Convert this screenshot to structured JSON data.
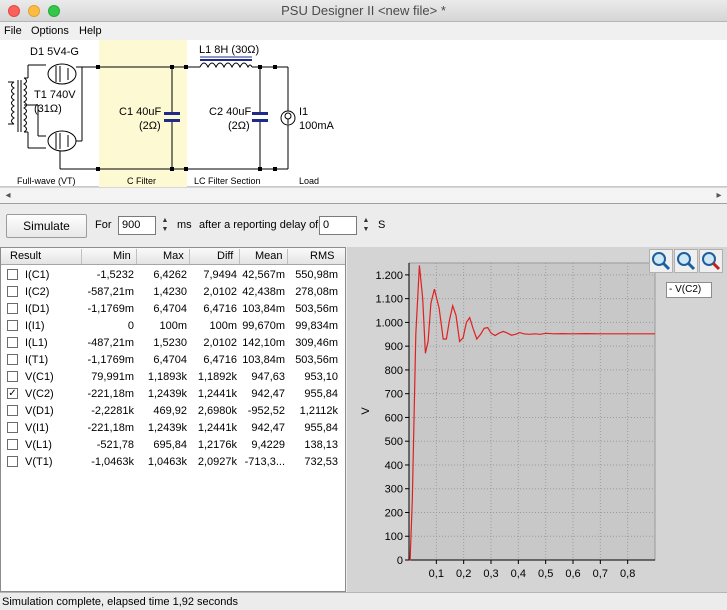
{
  "window": {
    "title": "PSU Designer II  <new file> *"
  },
  "menu": {
    "file": "File",
    "options": "Options",
    "help": "Help"
  },
  "circuit": {
    "rectifier_label": "D1 5V4-G",
    "transformer_label_1": "T1 740V",
    "transformer_label_2": "(31Ω)",
    "c1_label_1": "C1 40uF",
    "c1_label_2": "(2Ω)",
    "inductor_label": "L1 8H (30Ω)",
    "c2_label_1": "C2 40uF",
    "c2_label_2": "(2Ω)",
    "load_label_1": "I1",
    "load_label_2": "100mA",
    "section_fullwave": "Full-wave (VT)",
    "section_cfilter": "C Filter",
    "section_lc": "LC Filter Section",
    "section_load": "Load",
    "highlight_color": "#fdf9d3"
  },
  "toolbar": {
    "simulate": "Simulate",
    "for_label": "For",
    "duration_value": "900",
    "duration_unit": "ms",
    "delay_label": "after a reporting delay of",
    "delay_value": "0",
    "delay_unit": "S"
  },
  "table": {
    "headers": {
      "result": "Result",
      "min": "Min",
      "max": "Max",
      "diff": "Diff",
      "mean": "Mean",
      "rms": "RMS"
    },
    "rows": [
      {
        "name": "I(C1)",
        "checked": false,
        "min": "-1,5232",
        "max": "6,4262",
        "diff": "7,9494",
        "mean": "42,567m",
        "rms": "550,98m"
      },
      {
        "name": "I(C2)",
        "checked": false,
        "min": "-587,21m",
        "max": "1,4230",
        "diff": "2,0102",
        "mean": "42,438m",
        "rms": "278,08m"
      },
      {
        "name": "I(D1)",
        "checked": false,
        "min": "-1,1769m",
        "max": "6,4704",
        "diff": "6,4716",
        "mean": "103,84m",
        "rms": "503,56m"
      },
      {
        "name": "I(I1)",
        "checked": false,
        "min": "0",
        "max": "100m",
        "diff": "100m",
        "mean": "99,670m",
        "rms": "99,834m"
      },
      {
        "name": "I(L1)",
        "checked": false,
        "min": "-487,21m",
        "max": "1,5230",
        "diff": "2,0102",
        "mean": "142,10m",
        "rms": "309,46m"
      },
      {
        "name": "I(T1)",
        "checked": false,
        "min": "-1,1769m",
        "max": "6,4704",
        "diff": "6,4716",
        "mean": "103,84m",
        "rms": "503,56m"
      },
      {
        "name": "V(C1)",
        "checked": false,
        "min": "79,991m",
        "max": "1,1893k",
        "diff": "1,1892k",
        "mean": "947,63",
        "rms": "953,10"
      },
      {
        "name": "V(C2)",
        "checked": true,
        "min": "-221,18m",
        "max": "1,2439k",
        "diff": "1,2441k",
        "mean": "942,47",
        "rms": "955,84"
      },
      {
        "name": "V(D1)",
        "checked": false,
        "min": "-2,2281k",
        "max": "469,92",
        "diff": "2,6980k",
        "mean": "-952,52",
        "rms": "1,2112k"
      },
      {
        "name": "V(I1)",
        "checked": false,
        "min": "-221,18m",
        "max": "1,2439k",
        "diff": "1,2441k",
        "mean": "942,47",
        "rms": "955,84"
      },
      {
        "name": "V(L1)",
        "checked": false,
        "min": "-521,78",
        "max": "695,84",
        "diff": "1,2176k",
        "mean": "9,4229",
        "rms": "138,13"
      },
      {
        "name": "V(T1)",
        "checked": false,
        "min": "-1,0463k",
        "max": "1,0463k",
        "diff": "2,0927k",
        "mean": "-713,3...",
        "rms": "732,53"
      }
    ]
  },
  "graph": {
    "legend": "- V(C2)",
    "zoom_in_icon": "zoom-in-icon",
    "zoom_fit_icon": "zoom-fit-icon",
    "zoom_out_icon": "zoom-out-icon"
  },
  "chart_data": {
    "type": "line",
    "xlabel": "",
    "ylabel": "V",
    "x_ticks": [
      "0,1",
      "0,2",
      "0,3",
      "0,4",
      "0,5",
      "0,6",
      "0,7",
      "0,8"
    ],
    "y_ticks": [
      "0",
      "100",
      "200",
      "300",
      "400",
      "500",
      "600",
      "700",
      "800",
      "900",
      "1.000",
      "1.100",
      "1.200"
    ],
    "xlim": [
      0,
      0.9
    ],
    "ylim": [
      0,
      1250
    ],
    "grid": true,
    "series": [
      {
        "name": "V(C2)",
        "color": "#e02020",
        "x": [
          0,
          0.004,
          0.012,
          0.025,
          0.038,
          0.05,
          0.06,
          0.07,
          0.08,
          0.093,
          0.11,
          0.125,
          0.137,
          0.148,
          0.16,
          0.172,
          0.185,
          0.198,
          0.21,
          0.222,
          0.234,
          0.248,
          0.262,
          0.275,
          0.288,
          0.3,
          0.315,
          0.33,
          0.345,
          0.36,
          0.375,
          0.39,
          0.405,
          0.42,
          0.44,
          0.46,
          0.48,
          0.5,
          0.53,
          0.56,
          0.6,
          0.65,
          0.7,
          0.75,
          0.8,
          0.85,
          0.9
        ],
        "values": [
          0,
          0,
          250,
          950,
          1240,
          1100,
          870,
          920,
          1080,
          1140,
          1060,
          930,
          930,
          1010,
          1070,
          1030,
          920,
          935,
          1000,
          1020,
          975,
          930,
          950,
          975,
          978,
          955,
          945,
          955,
          962,
          955,
          946,
          950,
          957,
          952,
          950,
          952,
          950,
          954,
          952,
          953,
          952,
          953,
          952,
          952,
          952,
          952,
          952
        ]
      }
    ]
  },
  "status": {
    "text": "Simulation complete, elapsed time 1,92 seconds"
  }
}
